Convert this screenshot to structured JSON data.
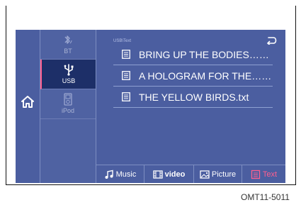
{
  "sources": [
    {
      "label": "BT",
      "icon": "bluetooth-icon"
    },
    {
      "label": "USB",
      "icon": "usb-icon"
    },
    {
      "label": "iPod",
      "icon": "ipod-icon"
    }
  ],
  "breadcrumb": "USB\\Text",
  "files": [
    "BRING UP THE BODIES……",
    "A HOLOGRAM FOR THE……",
    "THE YELLOW BIRDS.txt"
  ],
  "tabs": [
    {
      "label": "Music",
      "icon": "music-note-icon"
    },
    {
      "label": "video",
      "icon": "film-icon"
    },
    {
      "label": "Picture",
      "icon": "picture-icon"
    },
    {
      "label": "Text",
      "icon": "text-file-icon"
    }
  ],
  "footer_code": "OMT11-5011",
  "colors": {
    "screen_bg": "#4b5ea0",
    "active_source_bg": "#1d2f68",
    "accent": "#ff5f8f",
    "text": "#ffffff"
  }
}
